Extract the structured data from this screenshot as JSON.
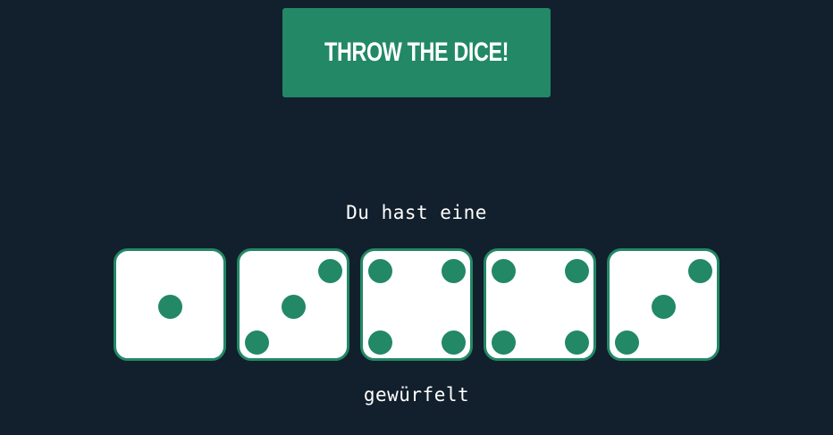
{
  "button": {
    "label": "THROW THE DICE!"
  },
  "result": {
    "prefix": "Du hast eine",
    "suffix": "gewürfelt"
  },
  "dice": [
    1,
    3,
    4,
    4,
    3
  ],
  "colors": {
    "background": "#121f2c",
    "accent": "#228866",
    "die_face": "#ffffff",
    "text": "#ffffff"
  }
}
